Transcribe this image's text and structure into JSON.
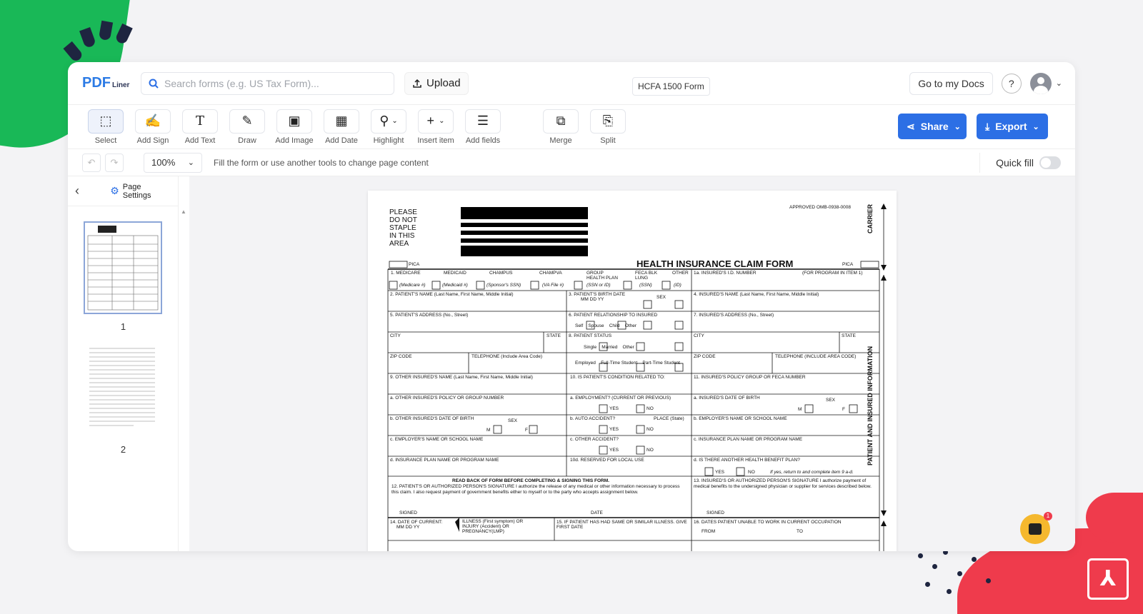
{
  "header": {
    "logo_text_1": "PDF",
    "logo_text_2": "Liner",
    "search_placeholder": "Search forms (e.g. US Tax Form)...",
    "upload_label": "Upload",
    "document_title": "HCFA 1500 Form",
    "go_to_docs_label": "Go to my Docs",
    "help_label": "?"
  },
  "toolbar": {
    "tools": [
      {
        "label": "Select",
        "icon": "select-icon"
      },
      {
        "label": "Add Sign",
        "icon": "sign-icon"
      },
      {
        "label": "Add Text",
        "icon": "text-icon"
      },
      {
        "label": "Draw",
        "icon": "pen-icon"
      },
      {
        "label": "Add Image",
        "icon": "image-icon"
      },
      {
        "label": "Add Date",
        "icon": "calendar-icon"
      },
      {
        "label": "Highlight",
        "icon": "highlight-icon"
      },
      {
        "label": "Insert item",
        "icon": "plus-icon"
      },
      {
        "label": "Add fields",
        "icon": "fields-icon"
      },
      {
        "label": "Merge",
        "icon": "merge-icon"
      },
      {
        "label": "Split",
        "icon": "split-icon"
      }
    ],
    "share_label": "Share",
    "export_label": "Export"
  },
  "options": {
    "zoom": "100%",
    "hint": "Fill the form or use another tools to change page content",
    "quick_fill_label": "Quick fill"
  },
  "sidebar": {
    "page_settings_label": "Page Settings",
    "pages": [
      "1",
      "2"
    ]
  },
  "form": {
    "staple_note": [
      "PLEASE",
      "DO NOT",
      "STAPLE",
      "IN THIS",
      "AREA"
    ],
    "approved": "APPROVED OMB-0938-0008",
    "title": "HEALTH INSURANCE CLAIM FORM",
    "pica_left": "PICA",
    "pica_right": "PICA",
    "carrier": "CARRIER",
    "patient_info": "PATIENT AND INSURED INFORMATION",
    "programs": [
      "1. MEDICARE",
      "MEDICAID",
      "CHAMPUS",
      "CHAMPVA",
      "GROUP HEALTH PLAN",
      "FECA BLK LUNG",
      "OTHER"
    ],
    "program_subs": [
      "(Medicare #)",
      "(Medicaid #)",
      "(Sponsor's SSN)",
      "(VA File #)",
      "(SSN or ID)",
      "(SSN)",
      "(ID)"
    ],
    "f1a": "1a. INSURED'S I.D. NUMBER",
    "f1a_note": "(FOR PROGRAM IN ITEM 1)",
    "f2": "2. PATIENT'S NAME (Last Name, First Name, Middle Initial)",
    "f3": "3. PATIENT'S BIRTH DATE",
    "f3_sex": "SEX",
    "f4": "4. INSURED'S NAME (Last Name, First Name, Middle Initial)",
    "f5": "5. PATIENT'S ADDRESS (No., Street)",
    "f6": "6. PATIENT RELATIONSHIP TO INSURED",
    "f6_opts": "Self    Spouse    Child    Other",
    "f7": "7. INSURED'S ADDRESS (No., Street)",
    "city": "CITY",
    "state": "STATE",
    "f8": "8. PATIENT STATUS",
    "f8_opts": "Single    Married    Other",
    "zip": "ZIP CODE",
    "tel": "TELEPHONE (Include Area Code)",
    "tel2": "TELEPHONE (INCLUDE AREA CODE)",
    "f8_emp": "Employed    Full-Time Student    Part-Time Student",
    "f9": "9. OTHER INSURED'S NAME (Last Name, First Name, Middle Initial)",
    "f10": "10. IS PATIENT'S CONDITION RELATED TO:",
    "f11": "11. INSURED'S POLICY GROUP OR FECA NUMBER",
    "f9a": "a. OTHER INSURED'S POLICY OR GROUP NUMBER",
    "f10a": "a. EMPLOYMENT? (CURRENT OR PREVIOUS)",
    "f11a": "a. INSURED'S DATE OF BIRTH",
    "f9b": "b. OTHER INSURED'S DATE OF BIRTH",
    "f10b": "b. AUTO ACCIDENT?",
    "f10b_place": "PLACE (State)",
    "f11b": "b. EMPLOYER'S NAME OR SCHOOL NAME",
    "f9c": "c. EMPLOYER'S NAME OR SCHOOL NAME",
    "f10c": "c. OTHER ACCIDENT?",
    "f11c": "c. INSURANCE PLAN NAME OR PROGRAM NAME",
    "f9d": "d. INSURANCE PLAN NAME OR PROGRAM NAME",
    "f10d": "10d. RESERVED FOR LOCAL USE",
    "f11d": "d. IS THERE ANOTHER HEALTH BENEFIT PLAN?",
    "f11d_note": "If yes, return to and complete item 9 a-d.",
    "yes": "YES",
    "no": "NO",
    "read_back": "READ BACK OF FORM BEFORE COMPLETING & SIGNING THIS FORM.",
    "f12": "12. PATIENT'S OR AUTHORIZED PERSON'S SIGNATURE I authorize the release of any medical or other information necessary to process this claim. I also request payment of government benefits either to myself or to the party who accepts assignment below.",
    "f13": "13. INSURED'S OR AUTHORIZED PERSON'S SIGNATURE I authorize payment of medical benefits to the undersigned physician or supplier for services described below.",
    "signed": "SIGNED",
    "date": "DATE",
    "f14": "14. DATE OF CURRENT:",
    "f14_note": "ILLNESS (First symptom) OR INJURY (Accident) OR PREGNANCY(LMP)",
    "f15": "15. IF PATIENT HAS HAD SAME OR SIMILAR ILLNESS. GIVE FIRST DATE",
    "f16": "16. DATES PATIENT UNABLE TO WORK IN CURRENT OCCUPATION",
    "from": "FROM",
    "to": "TO",
    "mmddyy": "MM   DD   YY",
    "m": "M",
    "f": "F"
  }
}
